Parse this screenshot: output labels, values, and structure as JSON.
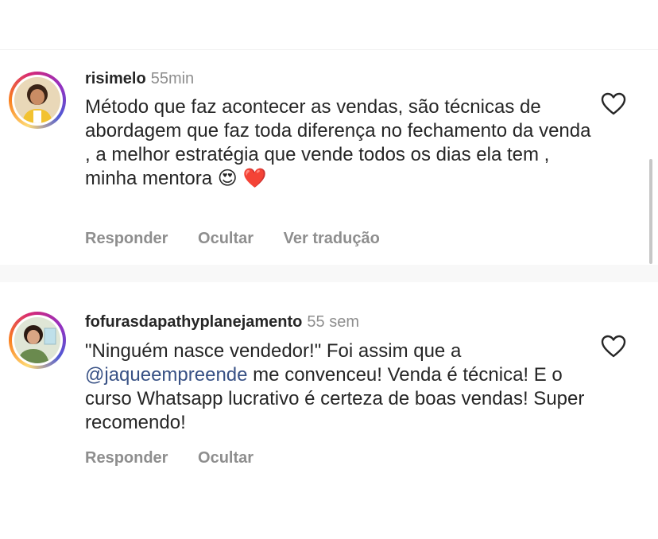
{
  "comments": [
    {
      "username": "risimelo",
      "time": "55min",
      "text": "Método que faz acontecer as vendas, são técnicas de abordagem que faz toda diferença no fechamento da venda , a melhor estratégia que vende todos os dias ela tem , minha mentora",
      "emojis": [
        "😍",
        "❤️"
      ],
      "actions": [
        "Responder",
        "Ocultar",
        "Ver tradução"
      ],
      "avatar_icon": "profile-photo",
      "like_icon": "heart-outline-icon"
    },
    {
      "username": "fofurasdapathyplanejamento",
      "time": "55 sem",
      "text_before": "\"Ninguém nasce vendedor!\" Foi assim que a ",
      "mention": "@jaqueempreende",
      "text_after": " me convenceu! Venda é técnica! E o curso Whatsapp lucrativo é certeza de boas vendas! Super recomendo!",
      "actions": [
        "Responder",
        "Ocultar"
      ],
      "avatar_icon": "profile-photo",
      "like_icon": "heart-outline-icon"
    }
  ],
  "colors": {
    "text": "#262626",
    "secondary": "#8e8e8e",
    "mention": "#385185",
    "separator": "#f8f8f8"
  }
}
